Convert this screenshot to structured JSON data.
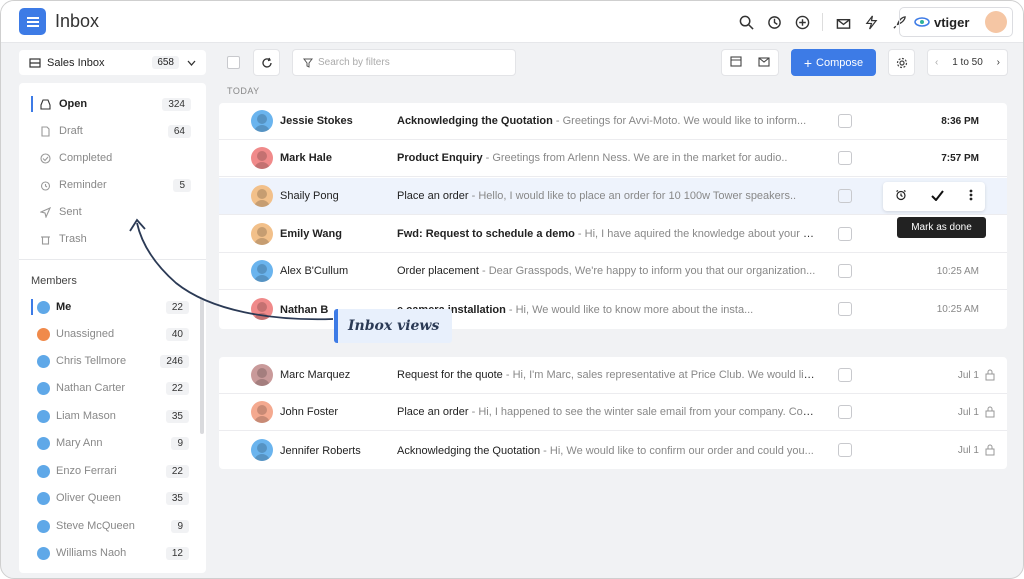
{
  "header": {
    "title": "Inbox",
    "brand": "vtiger"
  },
  "sidebar": {
    "inbox_selector": {
      "label": "Sales Inbox",
      "count": "658"
    },
    "folders": [
      {
        "label": "Open",
        "count": "324",
        "icon": "inbox-icon",
        "active": true
      },
      {
        "label": "Draft",
        "count": "64",
        "icon": "draft-icon"
      },
      {
        "label": "Completed",
        "count": "",
        "icon": "check-circle-icon"
      },
      {
        "label": "Reminder",
        "count": "5",
        "icon": "alarm-icon"
      },
      {
        "label": "Sent",
        "count": "",
        "icon": "send-icon"
      },
      {
        "label": "Trash",
        "count": "",
        "icon": "trash-icon"
      }
    ],
    "members_title": "Members",
    "members": [
      {
        "label": "Me",
        "count": "22",
        "active": true
      },
      {
        "label": "Unassigned",
        "count": "40"
      },
      {
        "label": "Chris Tellmore",
        "count": "246"
      },
      {
        "label": "Nathan Carter",
        "count": "22"
      },
      {
        "label": "Liam Mason",
        "count": "35"
      },
      {
        "label": "Mary Ann",
        "count": "9"
      },
      {
        "label": "Enzo Ferrari",
        "count": "22"
      },
      {
        "label": "Oliver Queen",
        "count": "35"
      },
      {
        "label": "Steve McQueen",
        "count": "9"
      },
      {
        "label": "Williams Naoh",
        "count": "12"
      }
    ]
  },
  "toolbar": {
    "search_placeholder": "Search by filters",
    "compose_label": "Compose",
    "pager_label": "1 to 50"
  },
  "section_today": "TODAY",
  "mails_today": [
    {
      "sender": "Jessie Stokes",
      "subject": "Acknowledging the Quotation",
      "preview": " - Greetings for Avvi-Moto. We would like to inform...",
      "time": "8:36 PM",
      "unread": true,
      "avatar": "blue"
    },
    {
      "sender": "Mark Hale",
      "subject": "Product Enquiry",
      "preview": " - Greetings from Arlenn Ness. We are in the market for audio..",
      "time": "7:57 PM",
      "unread": true,
      "avatar": "red"
    },
    {
      "sender": "Shaily Pong",
      "subject": "Place an order",
      "preview": " - Hello, I would like to place an order for 10 100w Tower speakers..",
      "time": "",
      "unread": false,
      "avatar": "tan"
    },
    {
      "sender": "Emily Wang",
      "subject": "Fwd: Request to schedule a demo",
      "preview": " - Hi, I have aquired the knowledge about your pro...",
      "time": "",
      "unread": true,
      "avatar": "tan"
    },
    {
      "sender": "Alex B'Cullum",
      "subject": "Order placement",
      "preview": " - Dear Grasspods, We're happy to inform you that our organization...",
      "time": "10:25 AM",
      "unread": false,
      "avatar": "blue"
    },
    {
      "sender": "Nathan B",
      "subject": "e camera installation",
      "preview": " - Hi, We would like to know more about the insta...",
      "time": "10:25 AM",
      "unread": true,
      "avatar": "red"
    }
  ],
  "mails_older": [
    {
      "sender": "Marc Marquez",
      "subject": "Request for the quote",
      "preview": " - Hi, I'm Marc, sales representative at Price Club. We would like...",
      "time": "Jul 1",
      "avatar": "brown"
    },
    {
      "sender": "John Foster",
      "subject": "Place an order",
      "preview": " - Hi, I happened to see the winter sale email from your company. Coul...",
      "time": "Jul 1",
      "avatar": "peach"
    },
    {
      "sender": "Jennifer Roberts",
      "subject": "Acknowledging the Quotation",
      "preview": " - Hi, We would like to confirm our order and could you...",
      "time": "Jul 1",
      "avatar": "blue"
    }
  ],
  "tooltip": "Mark as done",
  "callout": "Inbox views",
  "colors": {
    "accent": "#3d7be6",
    "background": "#f1f2f4"
  }
}
